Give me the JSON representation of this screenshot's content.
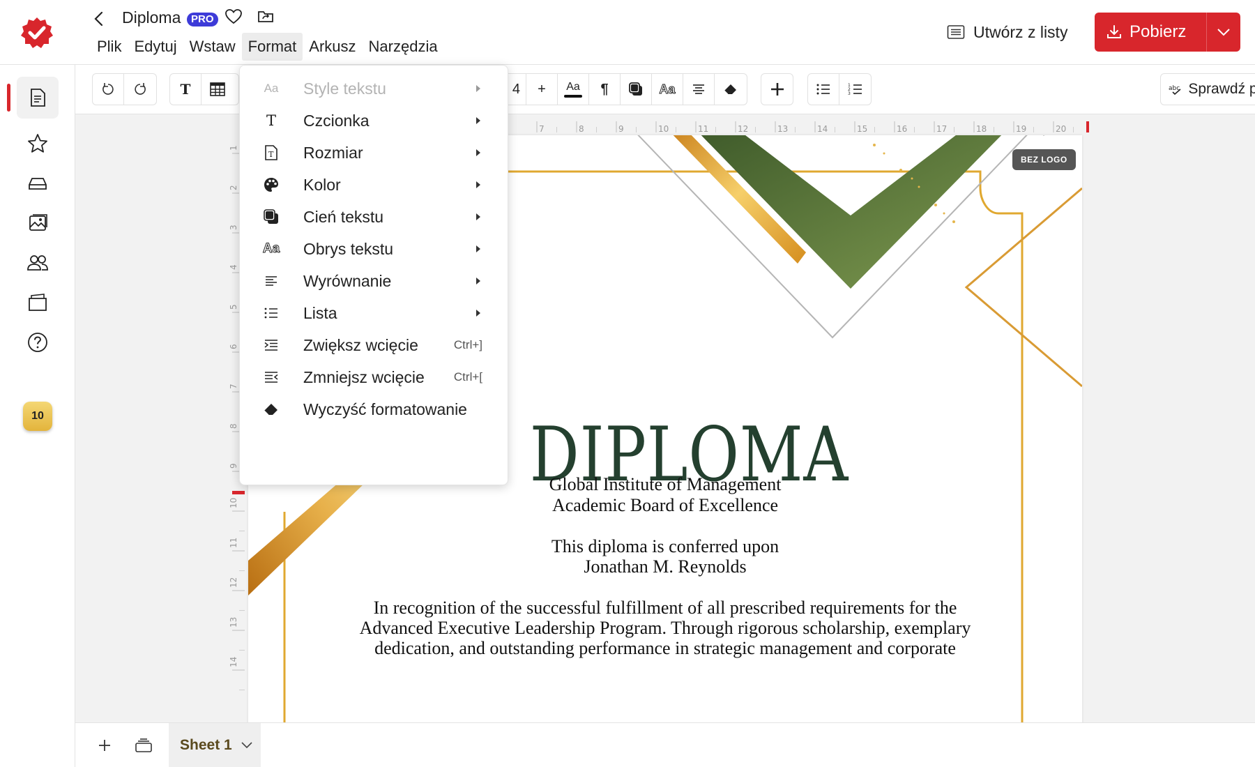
{
  "header": {
    "doc_title": "Diploma",
    "pro_badge": "PRO",
    "menu": [
      "Plik",
      "Edytuj",
      "Wstaw",
      "Format",
      "Arkusz",
      "Narzędzia"
    ],
    "active_menu": "Format",
    "create_from_list": "Utwórz z listy",
    "download": "Pobierz"
  },
  "sidebar": {
    "items": [
      "document-icon",
      "star-icon",
      "drive-icon",
      "image-icon",
      "users-icon",
      "folder-icon",
      "help-icon"
    ],
    "credits": "10"
  },
  "toolbar": {
    "text_tool": "T",
    "font_size_fragment": "4",
    "plus": "+",
    "text_style": "Aa",
    "paragraph": "¶",
    "outline": "Aa",
    "spellcheck": "Sprawdź pisownię"
  },
  "format_menu": {
    "items": [
      {
        "label": "Style tekstu",
        "icon": "text-style-icon",
        "submenu": true,
        "disabled": true,
        "shortcut": ""
      },
      {
        "label": "Czcionka",
        "icon": "font-icon",
        "submenu": true,
        "disabled": false,
        "shortcut": ""
      },
      {
        "label": "Rozmiar",
        "icon": "size-icon",
        "submenu": true,
        "disabled": false,
        "shortcut": ""
      },
      {
        "label": "Kolor",
        "icon": "palette-icon",
        "submenu": true,
        "disabled": false,
        "shortcut": ""
      },
      {
        "label": "Cień tekstu",
        "icon": "shadow-icon",
        "submenu": true,
        "disabled": false,
        "shortcut": ""
      },
      {
        "label": "Obrys tekstu",
        "icon": "outline-icon",
        "submenu": true,
        "disabled": false,
        "shortcut": ""
      },
      {
        "label": "Wyrównanie",
        "icon": "align-icon",
        "submenu": true,
        "disabled": false,
        "shortcut": ""
      },
      {
        "label": "Lista",
        "icon": "list-icon",
        "submenu": true,
        "disabled": false,
        "shortcut": ""
      },
      {
        "label": "Zwiększ wcięcie",
        "icon": "indent-increase-icon",
        "submenu": false,
        "disabled": false,
        "shortcut": "Ctrl+]"
      },
      {
        "label": "Zmniejsz wcięcie",
        "icon": "indent-decrease-icon",
        "submenu": false,
        "disabled": false,
        "shortcut": "Ctrl+["
      },
      {
        "label": "Wyczyść formatowanie",
        "icon": "eraser-icon",
        "submenu": false,
        "disabled": false,
        "shortcut": ""
      }
    ]
  },
  "rulers": {
    "top_numbers": [
      "7",
      "8",
      "9",
      "10",
      "11",
      "12",
      "13",
      "14",
      "15",
      "16",
      "17",
      "18",
      "19",
      "20"
    ],
    "left_numbers": [
      "1",
      "2",
      "3",
      "4",
      "5",
      "6",
      "7",
      "8",
      "9",
      "10",
      "11",
      "12",
      "13",
      "14"
    ]
  },
  "diploma": {
    "logo_badge": "BEZ LOGO",
    "title": "DIPLOMA",
    "institute": "Global Institute of Management",
    "board": "Academic Board of Excellence",
    "conferred": "This diploma is conferred upon",
    "recipient": "Jonathan M. Reynolds",
    "recognition_1": "In recognition of the successful fulfillment of all prescribed requirements for the",
    "recognition_2": "Advanced Executive Leadership Program. Through rigorous scholarship, exemplary",
    "recognition_3": "dedication, and outstanding performance in strategic management and corporate"
  },
  "bottombar": {
    "sheet_name": "Sheet 1"
  },
  "colors": {
    "brand_red": "#d8262c",
    "pro_blue": "#3d3bd8",
    "diploma_green": "#24402f",
    "gold": "#e0a830",
    "olive": "#5f7a3a"
  }
}
